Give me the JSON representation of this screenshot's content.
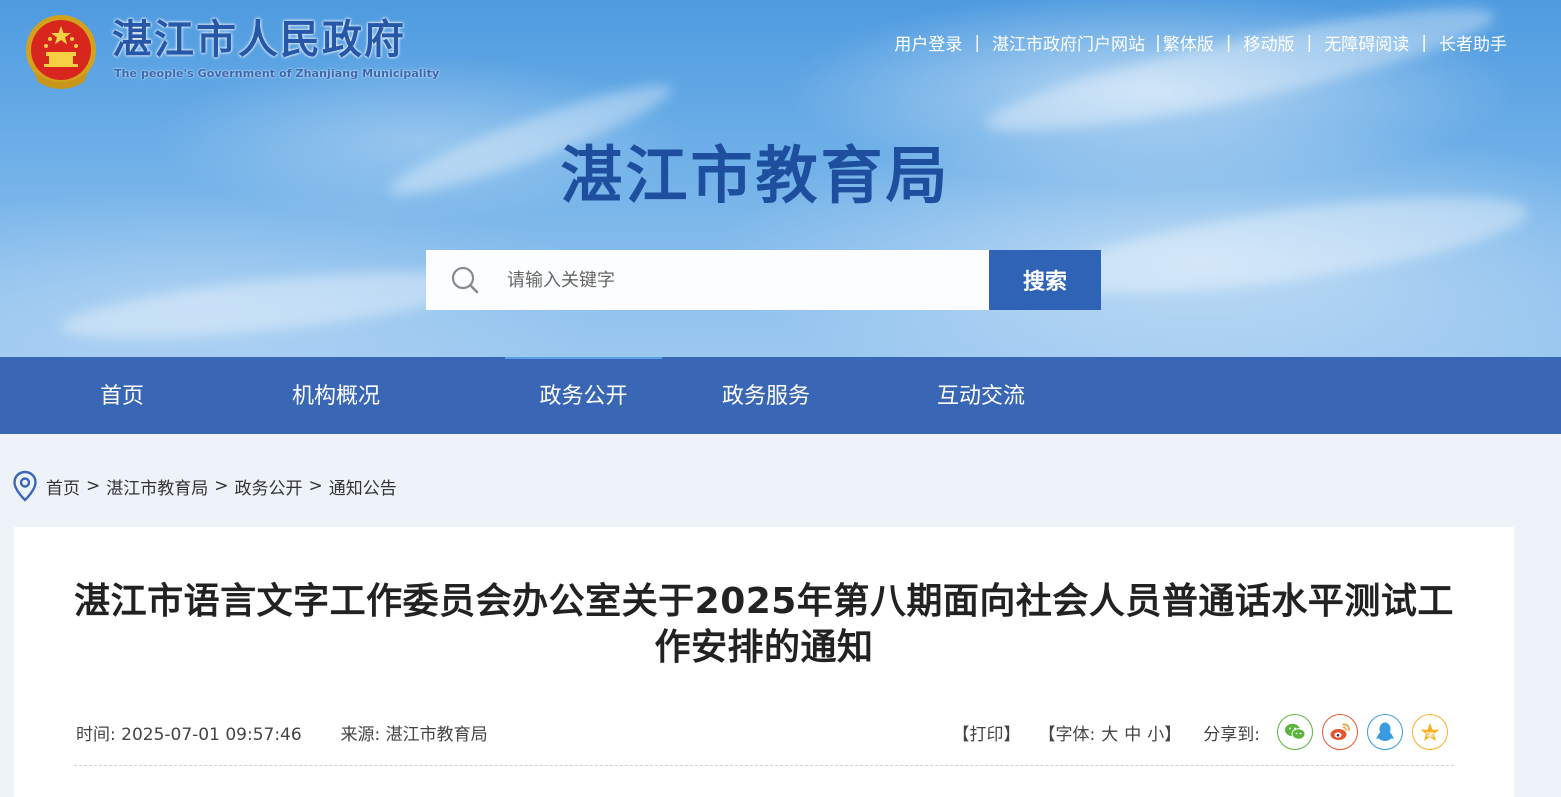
{
  "header": {
    "gov_name": "湛江市人民政府",
    "gov_name_en": "The people's Government of Zhanjiang Municipality",
    "top_links": [
      "用户登录",
      "湛江市政府门户网站",
      "繁体版",
      "移动版",
      "无障碍阅读",
      "长者助手"
    ],
    "site_title": "湛江市教育局"
  },
  "search": {
    "placeholder": "请输入关键字",
    "value": "",
    "button_label": "搜索"
  },
  "nav": {
    "items": [
      "首页",
      "机构概况",
      "政务公开",
      "政务服务",
      "互动交流"
    ],
    "active": "政务公开"
  },
  "breadcrumb": [
    "首页",
    "湛江市教育局",
    "政务公开",
    "通知公告"
  ],
  "breadcrumb_separator": ">",
  "article": {
    "title": "湛江市语言文字工作委员会办公室关于2025年第八期面向社会人员普通话水平测试工作安排的通知",
    "time_label": "时间:",
    "time_value": "2025-07-01 09:57:46",
    "source_label": "来源:",
    "source_value": "湛江市教育局",
    "print_label": "【打印】",
    "font_label": "【字体:",
    "font_sizes": [
      "大",
      "中",
      "小"
    ],
    "font_close": "】",
    "share_label": "分享到:",
    "share_icons": [
      "wechat-icon",
      "weibo-icon",
      "qq-icon",
      "qzone-icon"
    ]
  },
  "colors": {
    "nav_bg": "#3a66b6",
    "search_button_bg": "#2f63b6",
    "site_title": "#1d4f9e",
    "page_bg": "#eef3fa",
    "wechat": "#5bb53d",
    "weibo": "#e6562e",
    "qq": "#3a9be0",
    "qzone": "#f4b328"
  }
}
